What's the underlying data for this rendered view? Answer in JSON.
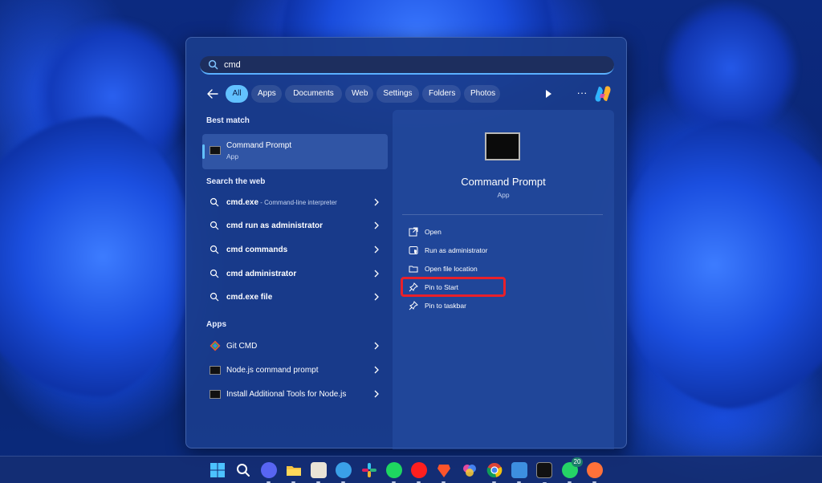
{
  "search": {
    "query": "cmd"
  },
  "filters": {
    "back": "back-arrow",
    "tabs": [
      "All",
      "Apps",
      "Documents",
      "Web",
      "Settings",
      "Folders",
      "Photos"
    ],
    "active": "All"
  },
  "best_match": {
    "heading": "Best match",
    "name": "Command Prompt",
    "type": "App"
  },
  "web": {
    "heading": "Search the web",
    "items": [
      {
        "bold": "cmd.exe",
        "sub": " - Command-line interpreter"
      },
      {
        "bold": "cmd run as administrator",
        "sub": ""
      },
      {
        "bold": "cmd commands",
        "sub": ""
      },
      {
        "bold": "cmd administrator",
        "sub": ""
      },
      {
        "bold": "cmd.exe file",
        "sub": ""
      }
    ]
  },
  "apps": {
    "heading": "Apps",
    "items": [
      {
        "name": "Git CMD",
        "icon": "git-icon"
      },
      {
        "name": "Node.js command prompt",
        "icon": "terminal-icon"
      },
      {
        "name": "Install Additional Tools for Node.js",
        "icon": "terminal-icon"
      }
    ]
  },
  "preview": {
    "title": "Command Prompt",
    "subtitle": "App",
    "actions": [
      {
        "label": "Open",
        "icon": "open-external-icon"
      },
      {
        "label": "Run as administrator",
        "icon": "shield-icon"
      },
      {
        "label": "Open file location",
        "icon": "folder-icon"
      },
      {
        "label": "Pin to Start",
        "icon": "pin-icon"
      },
      {
        "label": "Pin to taskbar",
        "icon": "pin-icon"
      }
    ]
  },
  "taskbar": {
    "whatsapp_badge": "20",
    "apps": [
      "start",
      "search",
      "discord",
      "file-explorer",
      "photos",
      "sync",
      "slack",
      "spotify",
      "youtube-music",
      "brave",
      "paint",
      "chrome",
      "photos-viewer",
      "terminal",
      "whatsapp",
      "firefox"
    ]
  },
  "colors": {
    "accent": "#62c1ff",
    "highlight": "#e8202a"
  }
}
